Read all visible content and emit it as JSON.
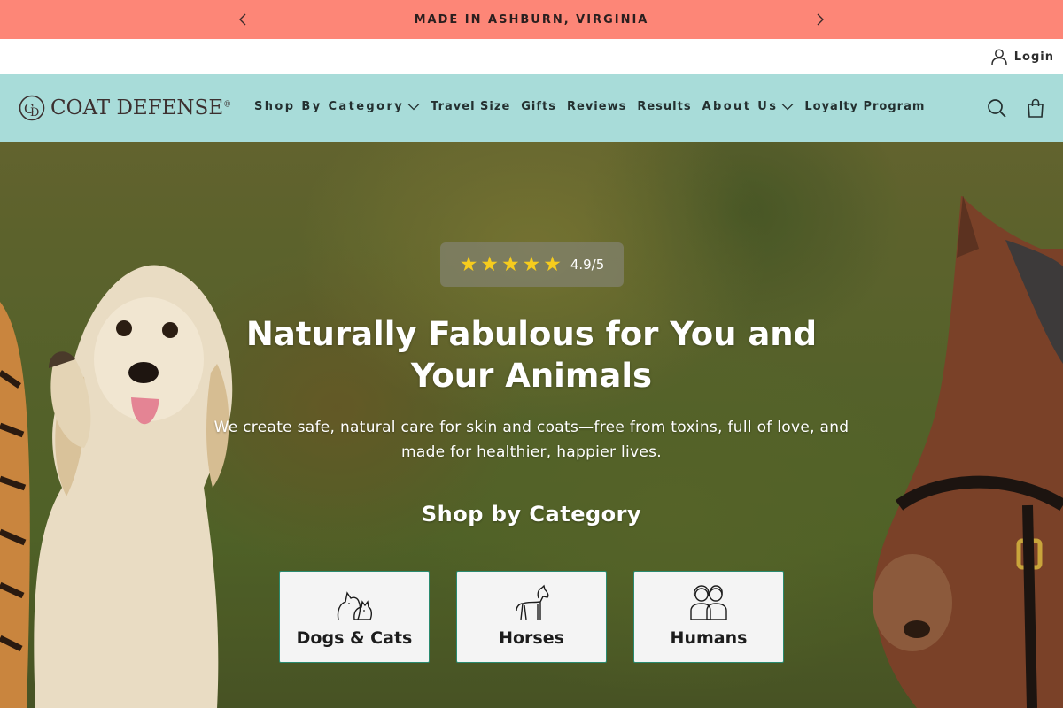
{
  "announcement": {
    "text": "MADE IN ASHBURN, VIRGINIA",
    "prev_icon": "chevron-left-icon",
    "next_icon": "chevron-right-icon"
  },
  "utility": {
    "login_label": "Login",
    "login_icon": "user-icon"
  },
  "header": {
    "logo_text": "COAT DEFENSE",
    "logo_mark": "®",
    "nav": [
      {
        "label": "Shop By Category",
        "has_dropdown": true
      },
      {
        "label": "Travel Size",
        "has_dropdown": false
      },
      {
        "label": "Gifts",
        "has_dropdown": false
      },
      {
        "label": "Reviews",
        "has_dropdown": false
      },
      {
        "label": "Results",
        "has_dropdown": false
      },
      {
        "label": "About Us",
        "has_dropdown": true
      },
      {
        "label": "Loyalty Program",
        "has_dropdown": false
      }
    ],
    "icons": [
      "search-icon",
      "shopping-bag-icon"
    ],
    "background": "#a8dcd9"
  },
  "hero": {
    "rating": {
      "stars": 5,
      "value": "4.9/5",
      "star_color": "#f6cc1d"
    },
    "title": "Naturally Fabulous for You and Your Animals",
    "subtitle": "We create safe, natural care for skin and coats—free from toxins, full of love, and made for healthier, happier lives.",
    "shop_heading": "Shop by Category",
    "categories": [
      {
        "label": "Dogs & Cats",
        "icon": "dog-cat-icon"
      },
      {
        "label": "Horses",
        "icon": "horse-icon"
      },
      {
        "label": "Humans",
        "icon": "people-icon"
      }
    ]
  },
  "colors": {
    "announcement_bg": "#fd8677",
    "card_border": "#2a8a6f"
  }
}
